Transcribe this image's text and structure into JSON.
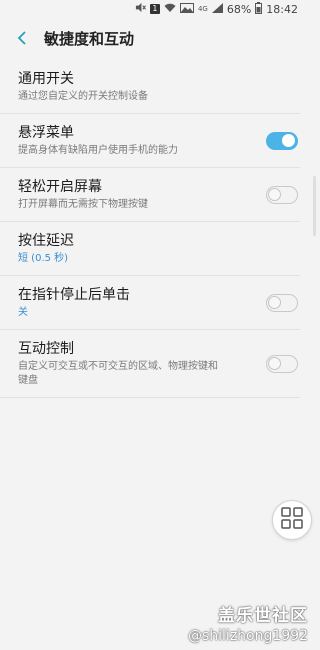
{
  "status_bar": {
    "sim_badge": "1",
    "network": "4G",
    "battery": "68%",
    "time": "18:42"
  },
  "header": {
    "title": "敏捷度和互动"
  },
  "items": [
    {
      "title": "通用开关",
      "subtitle": "通过您自定义的开关控制设备"
    },
    {
      "title": "悬浮菜单",
      "subtitle": "提高身体有缺陷用户使用手机的能力",
      "toggle": true
    },
    {
      "title": "轻松开启屏幕",
      "subtitle": "打开屏幕而无需按下物理按键",
      "toggle": false
    },
    {
      "title": "按住延迟",
      "subtitle": "短 (0.5 秒)"
    },
    {
      "title": "在指针停止后单击",
      "subtitle": "关",
      "toggle": false
    },
    {
      "title": "互动控制",
      "subtitle": "自定义可交互或不可交互的区域、物理按键和键盘",
      "toggle": false
    }
  ],
  "watermark": {
    "logo": "盖乐世社区",
    "user": "@shilizhong1992"
  },
  "colors": {
    "accent": "#4cb3e6",
    "link_blue": "#3a8fd0",
    "background": "#f3f3f3"
  }
}
